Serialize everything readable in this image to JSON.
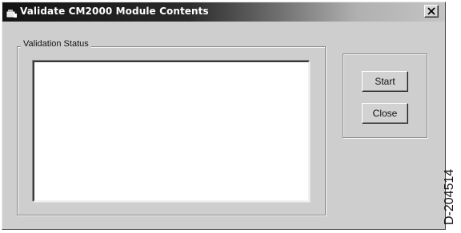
{
  "window": {
    "title": "Validate CM2000 Module Contents",
    "icon": "app-window-icon",
    "close_icon": "close-x-icon"
  },
  "validation_group": {
    "label": "Validation Status",
    "status_text": ""
  },
  "buttons": {
    "start_label": "Start",
    "close_label": "Close"
  },
  "figure_id": "D-204514",
  "colors": {
    "window_face": "#cecece",
    "titlebar_dark": "#141414",
    "titlebar_light": "#c4c4c4",
    "title_text": "#ffffff",
    "text_box": "#ffffff"
  }
}
